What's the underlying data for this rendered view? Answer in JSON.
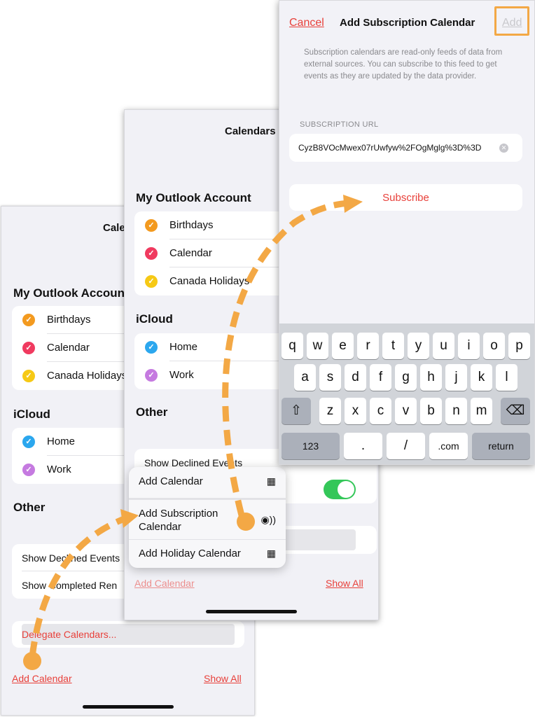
{
  "screen1": {
    "nav_title": "Cale",
    "sections": [
      {
        "title": "My Outlook Accoun"
      },
      {
        "title": "iCloud"
      },
      {
        "title": "Other"
      }
    ],
    "outlook_items": [
      {
        "label": "Birthdays",
        "color": "#f39a1f"
      },
      {
        "label": "Calendar",
        "color": "#f03a5f"
      },
      {
        "label": "Canada Holidays",
        "color": "#f6c915"
      }
    ],
    "icloud_items": [
      {
        "label": "Home",
        "color": "#2ba7ee"
      },
      {
        "label": "Work",
        "color": "#c57ae0"
      }
    ],
    "other_items": [
      "Show Declined Events",
      "Show Completed Ren"
    ],
    "delegate": "Delegate Calendars...",
    "add_calendar": "Add Calendar",
    "show_all": "Show All"
  },
  "screen2": {
    "nav_title": "Calendars",
    "sections": [
      {
        "title": "My Outlook Account"
      },
      {
        "title": "iCloud"
      },
      {
        "title": "Other"
      }
    ],
    "outlook_items": [
      {
        "label": "Birthdays",
        "color": "#f39a1f"
      },
      {
        "label": "Calendar",
        "color": "#f03a5f"
      },
      {
        "label": "Canada Holidays",
        "color": "#f6c915"
      }
    ],
    "icloud_items": [
      {
        "label": "Home",
        "color": "#2ba7ee"
      },
      {
        "label": "Work",
        "color": "#c57ae0"
      }
    ],
    "show_declined": "Show Declined Events",
    "add_calendar": "Add Calendar",
    "show_all": "Show All",
    "menu": [
      {
        "label": "Add Calendar",
        "icon": "calendar-add-icon"
      },
      {
        "label": "Add Subscription\nCalendar",
        "icon": "subscription-icon"
      },
      {
        "label": "Add Holiday Calendar",
        "icon": "calendar-add-icon"
      }
    ]
  },
  "screen3": {
    "cancel": "Cancel",
    "title": "Add Subscription Calendar",
    "add": "Add",
    "description": "Subscription calendars are read-only feeds of data from external sources. You can subscribe to this feed to get events as they are updated by the data provider.",
    "url_label": "SUBSCRIPTION URL",
    "url_value": "CyzB8VOcMwex07rUwfyw%2FOgMglg%3D%3D",
    "subscribe": "Subscribe",
    "keyboard": {
      "row1": [
        "q",
        "w",
        "e",
        "r",
        "t",
        "y",
        "u",
        "i",
        "o",
        "p"
      ],
      "row2": [
        "a",
        "s",
        "d",
        "f",
        "g",
        "h",
        "j",
        "k",
        "l"
      ],
      "row3": [
        "z",
        "x",
        "c",
        "v",
        "b",
        "n",
        "m"
      ],
      "num": "123",
      "dot": ".",
      "slash": "/",
      "com": ".com",
      "return": "return"
    }
  },
  "colors": {
    "accent": "#e8403a",
    "highlight": "#f3a845",
    "toggle_on": "#34c759"
  }
}
